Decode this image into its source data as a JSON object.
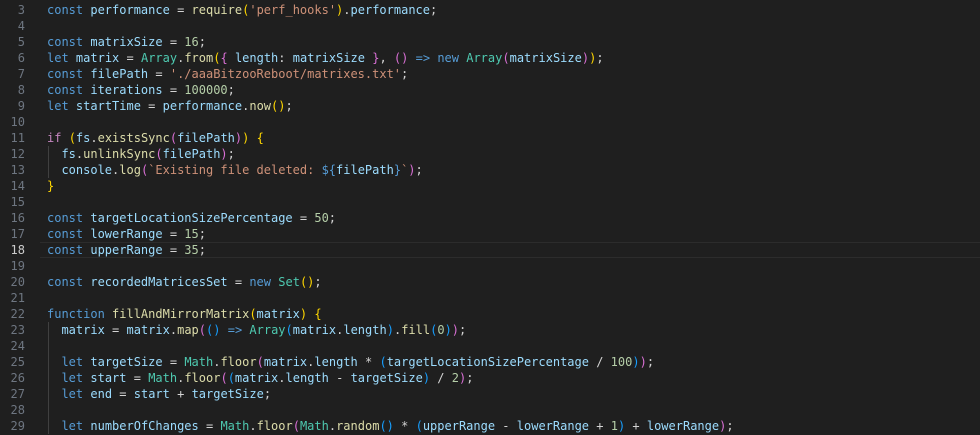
{
  "editor": {
    "lines": [
      {
        "num": "3",
        "tokens": [
          [
            "kw",
            "const"
          ],
          [
            "op",
            " "
          ],
          [
            "var",
            "performance"
          ],
          [
            "op",
            " = "
          ],
          [
            "fn",
            "require"
          ],
          [
            "br1",
            "("
          ],
          [
            "str",
            "'perf_hooks'"
          ],
          [
            "br1",
            ")"
          ],
          [
            "op",
            "."
          ],
          [
            "var",
            "performance"
          ],
          [
            "op",
            ";"
          ]
        ]
      },
      {
        "num": "4",
        "tokens": []
      },
      {
        "num": "5",
        "tokens": [
          [
            "kw",
            "const"
          ],
          [
            "op",
            " "
          ],
          [
            "var",
            "matrixSize"
          ],
          [
            "op",
            " = "
          ],
          [
            "num",
            "16"
          ],
          [
            "op",
            ";"
          ]
        ]
      },
      {
        "num": "6",
        "tokens": [
          [
            "kw",
            "let"
          ],
          [
            "op",
            " "
          ],
          [
            "var",
            "matrix"
          ],
          [
            "op",
            " = "
          ],
          [
            "cls",
            "Array"
          ],
          [
            "op",
            "."
          ],
          [
            "fn",
            "from"
          ],
          [
            "br1",
            "("
          ],
          [
            "br2",
            "{"
          ],
          [
            "op",
            " "
          ],
          [
            "var",
            "length"
          ],
          [
            "op",
            ": "
          ],
          [
            "var",
            "matrixSize"
          ],
          [
            "op",
            " "
          ],
          [
            "br2",
            "}"
          ],
          [
            "op",
            ", "
          ],
          [
            "br2",
            "("
          ],
          [
            "br2",
            ")"
          ],
          [
            "op",
            " "
          ],
          [
            "kw",
            "=>"
          ],
          [
            "op",
            " "
          ],
          [
            "kw",
            "new"
          ],
          [
            "op",
            " "
          ],
          [
            "cls",
            "Array"
          ],
          [
            "br2",
            "("
          ],
          [
            "var",
            "matrixSize"
          ],
          [
            "br2",
            ")"
          ],
          [
            "br1",
            ")"
          ],
          [
            "op",
            ";"
          ]
        ]
      },
      {
        "num": "7",
        "tokens": [
          [
            "kw",
            "const"
          ],
          [
            "op",
            " "
          ],
          [
            "var",
            "filePath"
          ],
          [
            "op",
            " = "
          ],
          [
            "str",
            "'./aaaBitzooReboot/matrixes.txt'"
          ],
          [
            "op",
            ";"
          ]
        ]
      },
      {
        "num": "8",
        "tokens": [
          [
            "kw",
            "const"
          ],
          [
            "op",
            " "
          ],
          [
            "var",
            "iterations"
          ],
          [
            "op",
            " = "
          ],
          [
            "num",
            "100000"
          ],
          [
            "op",
            ";"
          ]
        ]
      },
      {
        "num": "9",
        "tokens": [
          [
            "kw",
            "let"
          ],
          [
            "op",
            " "
          ],
          [
            "var",
            "startTime"
          ],
          [
            "op",
            " = "
          ],
          [
            "var",
            "performance"
          ],
          [
            "op",
            "."
          ],
          [
            "fn",
            "now"
          ],
          [
            "br1",
            "("
          ],
          [
            "br1",
            ")"
          ],
          [
            "op",
            ";"
          ]
        ]
      },
      {
        "num": "10",
        "tokens": []
      },
      {
        "num": "11",
        "tokens": [
          [
            "ctl",
            "if"
          ],
          [
            "op",
            " "
          ],
          [
            "br1",
            "("
          ],
          [
            "var",
            "fs"
          ],
          [
            "op",
            "."
          ],
          [
            "fn",
            "existsSync"
          ],
          [
            "br2",
            "("
          ],
          [
            "var",
            "filePath"
          ],
          [
            "br2",
            ")"
          ],
          [
            "br1",
            ")"
          ],
          [
            "op",
            " "
          ],
          [
            "br1",
            "{"
          ]
        ]
      },
      {
        "num": "12",
        "guide": true,
        "tokens": [
          [
            "op",
            "  "
          ],
          [
            "var",
            "fs"
          ],
          [
            "op",
            "."
          ],
          [
            "fn",
            "unlinkSync"
          ],
          [
            "br2",
            "("
          ],
          [
            "var",
            "filePath"
          ],
          [
            "br2",
            ")"
          ],
          [
            "op",
            ";"
          ]
        ]
      },
      {
        "num": "13",
        "guide": true,
        "tokens": [
          [
            "op",
            "  "
          ],
          [
            "var",
            "console"
          ],
          [
            "op",
            "."
          ],
          [
            "fn",
            "log"
          ],
          [
            "br2",
            "("
          ],
          [
            "str",
            "`Existing file deleted: "
          ],
          [
            "kw",
            "${"
          ],
          [
            "var",
            "filePath"
          ],
          [
            "kw",
            "}"
          ],
          [
            "str",
            "`"
          ],
          [
            "br2",
            ")"
          ],
          [
            "op",
            ";"
          ]
        ]
      },
      {
        "num": "14",
        "tokens": [
          [
            "br1",
            "}"
          ]
        ]
      },
      {
        "num": "15",
        "tokens": []
      },
      {
        "num": "16",
        "tokens": [
          [
            "kw",
            "const"
          ],
          [
            "op",
            " "
          ],
          [
            "var",
            "targetLocationSizePercentage"
          ],
          [
            "op",
            " = "
          ],
          [
            "num",
            "50"
          ],
          [
            "op",
            ";"
          ]
        ]
      },
      {
        "num": "17",
        "tokens": [
          [
            "kw",
            "const"
          ],
          [
            "op",
            " "
          ],
          [
            "var",
            "lowerRange"
          ],
          [
            "op",
            " = "
          ],
          [
            "num",
            "15"
          ],
          [
            "op",
            ";"
          ]
        ]
      },
      {
        "num": "18",
        "current": true,
        "tokens": [
          [
            "kw",
            "const"
          ],
          [
            "op",
            " "
          ],
          [
            "var",
            "upperRange"
          ],
          [
            "op",
            " = "
          ],
          [
            "num",
            "35"
          ],
          [
            "op",
            ";"
          ]
        ]
      },
      {
        "num": "19",
        "tokens": []
      },
      {
        "num": "20",
        "tokens": [
          [
            "kw",
            "const"
          ],
          [
            "op",
            " "
          ],
          [
            "var",
            "recordedMatricesSet"
          ],
          [
            "op",
            " = "
          ],
          [
            "kw",
            "new"
          ],
          [
            "op",
            " "
          ],
          [
            "cls",
            "Set"
          ],
          [
            "br1",
            "("
          ],
          [
            "br1",
            ")"
          ],
          [
            "op",
            ";"
          ]
        ]
      },
      {
        "num": "21",
        "tokens": []
      },
      {
        "num": "22",
        "tokens": [
          [
            "kw",
            "function"
          ],
          [
            "op",
            " "
          ],
          [
            "fn",
            "fillAndMirrorMatrix"
          ],
          [
            "br1",
            "("
          ],
          [
            "var",
            "matrix"
          ],
          [
            "br1",
            ")"
          ],
          [
            "op",
            " "
          ],
          [
            "br1",
            "{"
          ]
        ]
      },
      {
        "num": "23",
        "guide": true,
        "tokens": [
          [
            "op",
            "  "
          ],
          [
            "var",
            "matrix"
          ],
          [
            "op",
            " = "
          ],
          [
            "var",
            "matrix"
          ],
          [
            "op",
            "."
          ],
          [
            "fn",
            "map"
          ],
          [
            "br2",
            "("
          ],
          [
            "br3",
            "("
          ],
          [
            "br3",
            ")"
          ],
          [
            "op",
            " "
          ],
          [
            "kw",
            "=>"
          ],
          [
            "op",
            " "
          ],
          [
            "cls",
            "Array"
          ],
          [
            "br3",
            "("
          ],
          [
            "var",
            "matrix"
          ],
          [
            "op",
            "."
          ],
          [
            "var",
            "length"
          ],
          [
            "br3",
            ")"
          ],
          [
            "op",
            "."
          ],
          [
            "fn",
            "fill"
          ],
          [
            "br3",
            "("
          ],
          [
            "num",
            "0"
          ],
          [
            "br3",
            ")"
          ],
          [
            "br2",
            ")"
          ],
          [
            "op",
            ";"
          ]
        ]
      },
      {
        "num": "24",
        "guide": true,
        "tokens": []
      },
      {
        "num": "25",
        "guide": true,
        "tokens": [
          [
            "op",
            "  "
          ],
          [
            "kw",
            "let"
          ],
          [
            "op",
            " "
          ],
          [
            "var",
            "targetSize"
          ],
          [
            "op",
            " = "
          ],
          [
            "cls",
            "Math"
          ],
          [
            "op",
            "."
          ],
          [
            "fn",
            "floor"
          ],
          [
            "br2",
            "("
          ],
          [
            "var",
            "matrix"
          ],
          [
            "op",
            "."
          ],
          [
            "var",
            "length"
          ],
          [
            "op",
            " * "
          ],
          [
            "br3",
            "("
          ],
          [
            "var",
            "targetLocationSizePercentage"
          ],
          [
            "op",
            " / "
          ],
          [
            "num",
            "100"
          ],
          [
            "br3",
            ")"
          ],
          [
            "br2",
            ")"
          ],
          [
            "op",
            ";"
          ]
        ]
      },
      {
        "num": "26",
        "guide": true,
        "tokens": [
          [
            "op",
            "  "
          ],
          [
            "kw",
            "let"
          ],
          [
            "op",
            " "
          ],
          [
            "var",
            "start"
          ],
          [
            "op",
            " = "
          ],
          [
            "cls",
            "Math"
          ],
          [
            "op",
            "."
          ],
          [
            "fn",
            "floor"
          ],
          [
            "br2",
            "("
          ],
          [
            "br3",
            "("
          ],
          [
            "var",
            "matrix"
          ],
          [
            "op",
            "."
          ],
          [
            "var",
            "length"
          ],
          [
            "op",
            " - "
          ],
          [
            "var",
            "targetSize"
          ],
          [
            "br3",
            ")"
          ],
          [
            "op",
            " / "
          ],
          [
            "num",
            "2"
          ],
          [
            "br2",
            ")"
          ],
          [
            "op",
            ";"
          ]
        ]
      },
      {
        "num": "27",
        "guide": true,
        "tokens": [
          [
            "op",
            "  "
          ],
          [
            "kw",
            "let"
          ],
          [
            "op",
            " "
          ],
          [
            "var",
            "end"
          ],
          [
            "op",
            " = "
          ],
          [
            "var",
            "start"
          ],
          [
            "op",
            " + "
          ],
          [
            "var",
            "targetSize"
          ],
          [
            "op",
            ";"
          ]
        ]
      },
      {
        "num": "28",
        "guide": true,
        "tokens": []
      },
      {
        "num": "29",
        "guide": true,
        "tokens": [
          [
            "op",
            "  "
          ],
          [
            "kw",
            "let"
          ],
          [
            "op",
            " "
          ],
          [
            "var",
            "numberOfChanges"
          ],
          [
            "op",
            " = "
          ],
          [
            "cls",
            "Math"
          ],
          [
            "op",
            "."
          ],
          [
            "fn",
            "floor"
          ],
          [
            "br2",
            "("
          ],
          [
            "cls",
            "Math"
          ],
          [
            "op",
            "."
          ],
          [
            "fn",
            "random"
          ],
          [
            "br3",
            "("
          ],
          [
            "br3",
            ")"
          ],
          [
            "op",
            " * "
          ],
          [
            "br3",
            "("
          ],
          [
            "var",
            "upperRange"
          ],
          [
            "op",
            " - "
          ],
          [
            "var",
            "lowerRange"
          ],
          [
            "op",
            " + "
          ],
          [
            "num",
            "1"
          ],
          [
            "br3",
            ")"
          ],
          [
            "op",
            " + "
          ],
          [
            "var",
            "lowerRange"
          ],
          [
            "br2",
            ")"
          ],
          [
            "op",
            ";"
          ]
        ]
      }
    ]
  }
}
